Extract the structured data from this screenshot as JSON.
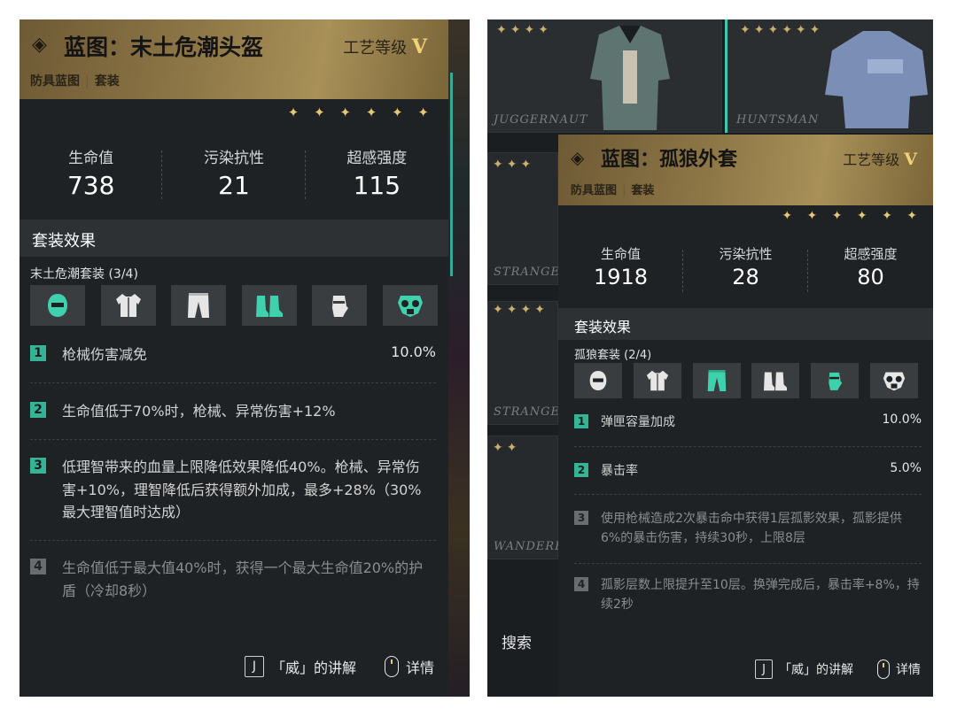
{
  "left_card": {
    "title": "蓝图：末土危潮头盔",
    "craft_label": "工艺等级",
    "craft_level": "V",
    "category": "防具蓝图",
    "subcategory": "套装",
    "stars": "✦ ✦ ✦ ✦ ✦ ✦",
    "stats": [
      {
        "label": "生命值",
        "value": "738"
      },
      {
        "label": "污染抗性",
        "value": "21"
      },
      {
        "label": "超感强度",
        "value": "115"
      }
    ],
    "set_header": "套装效果",
    "set_name": "末土危潮套装 (3/4)",
    "effects": [
      {
        "num": "1",
        "text": "枪械伤害减免",
        "value": "10.0%",
        "active": true
      },
      {
        "num": "2",
        "text": "生命值低于70%时，枪械、异常伤害+12%",
        "value": "",
        "active": true
      },
      {
        "num": "3",
        "text": "低理智带来的血量上限降低效果降低40%。枪械、异常伤害+10%，理智降低后获得额外加成，最多+28%（30%最大理智值时达成）",
        "value": "",
        "active": true
      },
      {
        "num": "4",
        "text": "生命值低于最大值40%时，获得一个最大生命值20%的护盾（冷却8秒）",
        "value": "",
        "active": false
      }
    ],
    "footer_key": "J",
    "footer_hint": "「威」的讲解",
    "footer_detail": "详情"
  },
  "right_panel": {
    "bg_labels": [
      "JUGGERNAUT",
      "HUNTSMAN",
      "STRANGER",
      "STRANGER",
      "WANDERER"
    ],
    "search_label": "搜索"
  },
  "right_card": {
    "title": "蓝图：孤狼外套",
    "craft_label": "工艺等级",
    "craft_level": "V",
    "category": "防具蓝图",
    "subcategory": "套装",
    "stars": "✦ ✦ ✦ ✦ ✦ ✦",
    "stats": [
      {
        "label": "生命值",
        "value": "1918"
      },
      {
        "label": "污染抗性",
        "value": "28"
      },
      {
        "label": "超感强度",
        "value": "80"
      }
    ],
    "set_header": "套装效果",
    "set_name": "孤狼套装 (2/4)",
    "effects": [
      {
        "num": "1",
        "text": "弹匣容量加成",
        "value": "10.0%",
        "active": true
      },
      {
        "num": "2",
        "text": "暴击率",
        "value": "5.0%",
        "active": true
      },
      {
        "num": "3",
        "text": "使用枪械造成2次暴击命中获得1层孤影效果，孤影提供6%的暴击伤害，持续30秒，上限8层",
        "value": "",
        "active": false
      },
      {
        "num": "4",
        "text": "孤影层数上限提升至10层。换弹完成后，暴击率+8%，持续2秒",
        "value": "",
        "active": false
      }
    ],
    "footer_key": "J",
    "footer_hint": "「威」的讲解",
    "footer_detail": "详情"
  },
  "colors": {
    "accent_teal": "#34b494",
    "gold": "#e6c877",
    "header_gold": "#a89058"
  },
  "icons": {
    "left_set": [
      {
        "name": "helmet-icon",
        "active": true
      },
      {
        "name": "vest-icon",
        "active": false
      },
      {
        "name": "pants-icon",
        "active": false
      },
      {
        "name": "boots-icon",
        "active": true
      },
      {
        "name": "gloves-icon",
        "active": false
      },
      {
        "name": "mask-icon",
        "active": true
      }
    ],
    "right_set": [
      {
        "name": "helmet-icon",
        "active": false
      },
      {
        "name": "vest-icon",
        "active": false
      },
      {
        "name": "pants-icon",
        "active": true
      },
      {
        "name": "boots-icon",
        "active": false
      },
      {
        "name": "gloves-icon",
        "active": true
      },
      {
        "name": "mask-icon",
        "active": false
      }
    ]
  }
}
